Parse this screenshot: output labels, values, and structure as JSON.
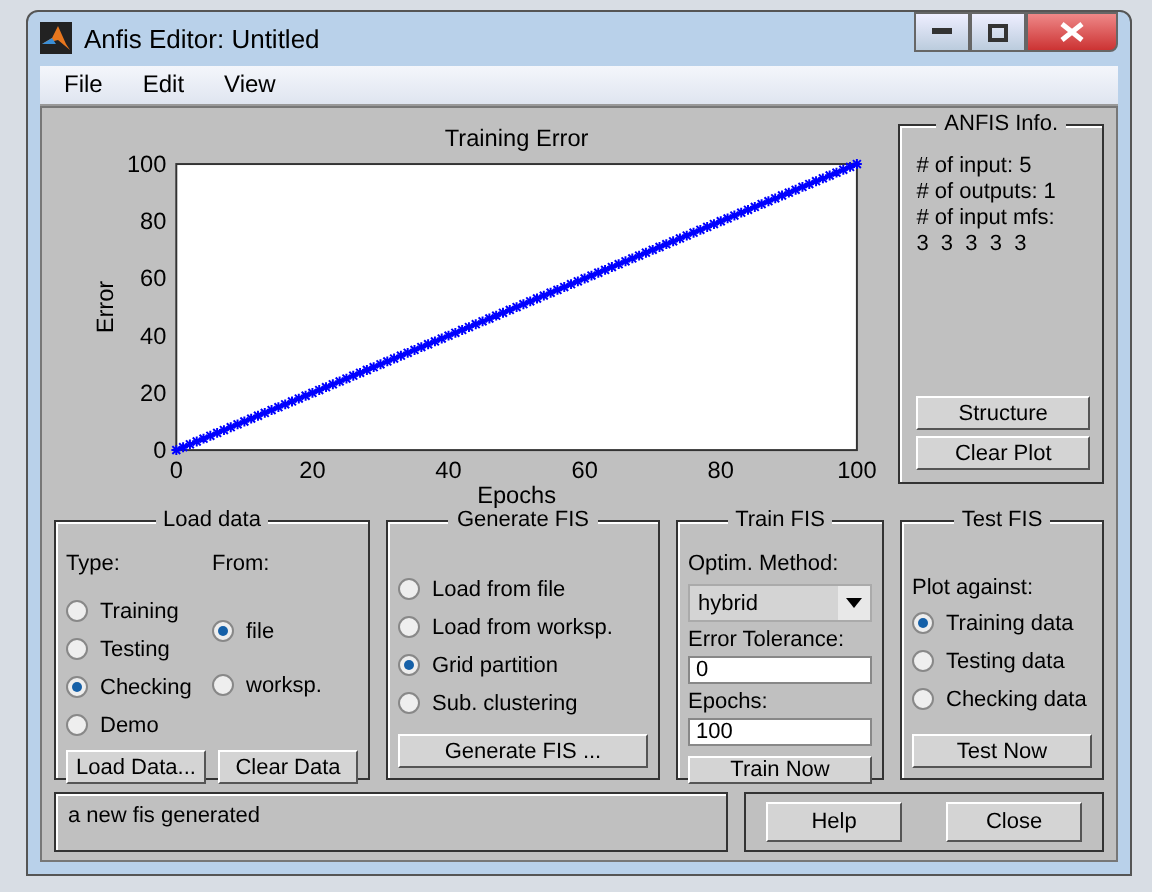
{
  "window": {
    "title": "Anfis Editor: Untitled"
  },
  "menu": [
    "File",
    "Edit",
    "View"
  ],
  "plot": {
    "chart_data": {
      "type": "line",
      "title": "Training Error",
      "xlabel": "Epochs",
      "ylabel": "Error",
      "x": [
        0,
        10,
        20,
        30,
        40,
        50,
        60,
        70,
        80,
        90,
        100
      ],
      "series": [
        {
          "color": "#0000ff",
          "line_style": "solid",
          "marker": "cross",
          "values": [
            0,
            10,
            20,
            30,
            40,
            50,
            60,
            70,
            80,
            90,
            100
          ]
        }
      ],
      "xlim": [
        0,
        100
      ],
      "ylim": [
        0,
        100
      ],
      "xticks": [
        0,
        20,
        40,
        60,
        80,
        100
      ],
      "yticks": [
        0,
        20,
        40,
        60,
        80,
        100
      ]
    }
  },
  "anfis_info": {
    "title": "ANFIS Info.",
    "lines": [
      "# of input: 5",
      "# of outputs: 1",
      "# of input mfs:",
      "3  3  3  3  3"
    ],
    "buttons": [
      "Structure",
      "Clear Plot"
    ]
  },
  "load_data": {
    "title": "Load data",
    "type_label": "Type:",
    "from_label": "From:",
    "types": [
      {
        "label": "Training",
        "selected": false
      },
      {
        "label": "Testing",
        "selected": false
      },
      {
        "label": "Checking",
        "selected": true
      },
      {
        "label": "Demo",
        "selected": false
      }
    ],
    "sources": [
      {
        "label": "file",
        "selected": true
      },
      {
        "label": "worksp.",
        "selected": false
      }
    ],
    "buttons": [
      "Load Data...",
      "Clear Data"
    ]
  },
  "generate_fis": {
    "title": "Generate FIS",
    "options": [
      {
        "label": "Load from file",
        "selected": false
      },
      {
        "label": "Load from worksp.",
        "selected": false
      },
      {
        "label": "Grid partition",
        "selected": true
      },
      {
        "label": "Sub. clustering",
        "selected": false
      }
    ],
    "button": "Generate FIS ..."
  },
  "train_fis": {
    "title": "Train FIS",
    "method_label": "Optim. Method:",
    "method": "hybrid",
    "tolerance_label": "Error Tolerance:",
    "tolerance": "0",
    "epochs_label": "Epochs:",
    "epochs": "100",
    "button": "Train Now"
  },
  "test_fis": {
    "title": "Test FIS",
    "plot_label": "Plot against:",
    "options": [
      {
        "label": "Training data",
        "selected": true
      },
      {
        "label": "Testing data",
        "selected": false
      },
      {
        "label": "Checking data",
        "selected": false
      }
    ],
    "button": "Test Now"
  },
  "status": "a new fis generated",
  "buttons": [
    "Help",
    "Close"
  ]
}
